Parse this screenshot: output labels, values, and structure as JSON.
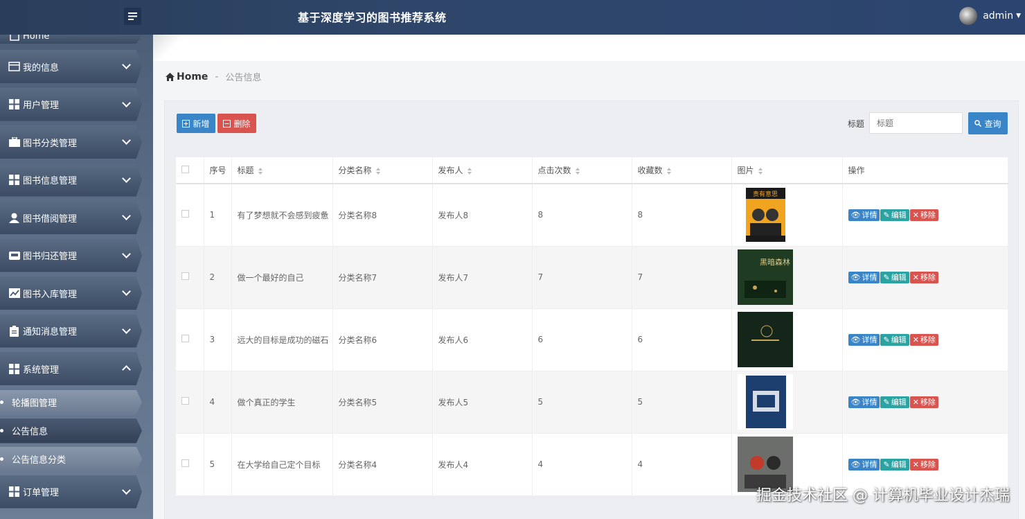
{
  "header": {
    "title": "基于深度学习的图书推荐系统",
    "user": "admin"
  },
  "sidebar": {
    "home_partial": "Home",
    "items": [
      {
        "label": "我的信息",
        "icon": "id-card-icon"
      },
      {
        "label": "用户管理",
        "icon": "grid-icon"
      },
      {
        "label": "图书分类管理",
        "icon": "briefcase-icon"
      },
      {
        "label": "图书信息管理",
        "icon": "grid-icon"
      },
      {
        "label": "图书借阅管理",
        "icon": "user-icon"
      },
      {
        "label": "图书归还管理",
        "icon": "inbox-icon"
      },
      {
        "label": "图书入库管理",
        "icon": "chart-icon"
      },
      {
        "label": "通知消息管理",
        "icon": "clipboard-icon"
      },
      {
        "label": "系统管理",
        "icon": "grid-icon"
      }
    ],
    "sub_items": [
      "轮播图管理",
      "公告信息",
      "公告信息分类"
    ],
    "last_item": {
      "label": "订单管理",
      "icon": "grid-icon"
    }
  },
  "breadcrumb": {
    "home": "Home",
    "separator": "-",
    "current": "公告信息"
  },
  "toolbar": {
    "add_label": "新增",
    "delete_label": "删除",
    "search_label": "标题",
    "search_placeholder": "标题",
    "query_label": "查询"
  },
  "table": {
    "headers": [
      "序号",
      "标题",
      "分类名称",
      "发布人",
      "点击次数",
      "收藏数",
      "图片",
      "操作"
    ],
    "rows": [
      {
        "no": "1",
        "title": "有了梦想就不会感到疲惫",
        "category": "分类名称8",
        "publisher": "发布人8",
        "clicks": "8",
        "favorites": "8",
        "cover_text": "责有意思"
      },
      {
        "no": "2",
        "title": "做一个最好的自己",
        "category": "分类名称7",
        "publisher": "发布人7",
        "clicks": "7",
        "favorites": "7",
        "cover_text": "黑暗森林"
      },
      {
        "no": "3",
        "title": "远大的目标是成功的磁石",
        "category": "分类名称6",
        "publisher": "发布人6",
        "clicks": "6",
        "favorites": "6",
        "cover_text": ""
      },
      {
        "no": "4",
        "title": "做个真正的学生",
        "category": "分类名称5",
        "publisher": "发布人5",
        "clicks": "5",
        "favorites": "5",
        "cover_text": ""
      },
      {
        "no": "5",
        "title": "在大学给自己定个目标",
        "category": "分类名称4",
        "publisher": "发布人4",
        "clicks": "4",
        "favorites": "4",
        "cover_text": ""
      }
    ],
    "actions": {
      "detail": "详情",
      "edit": "编辑",
      "remove": "移除"
    }
  },
  "watermark": "掘金技术社区 @ 计算机毕业设计杰瑞",
  "colors": {
    "primary": "#3a85c8",
    "danger": "#d9534f",
    "teal": "#2ba3a3",
    "header": "#2c4570"
  }
}
